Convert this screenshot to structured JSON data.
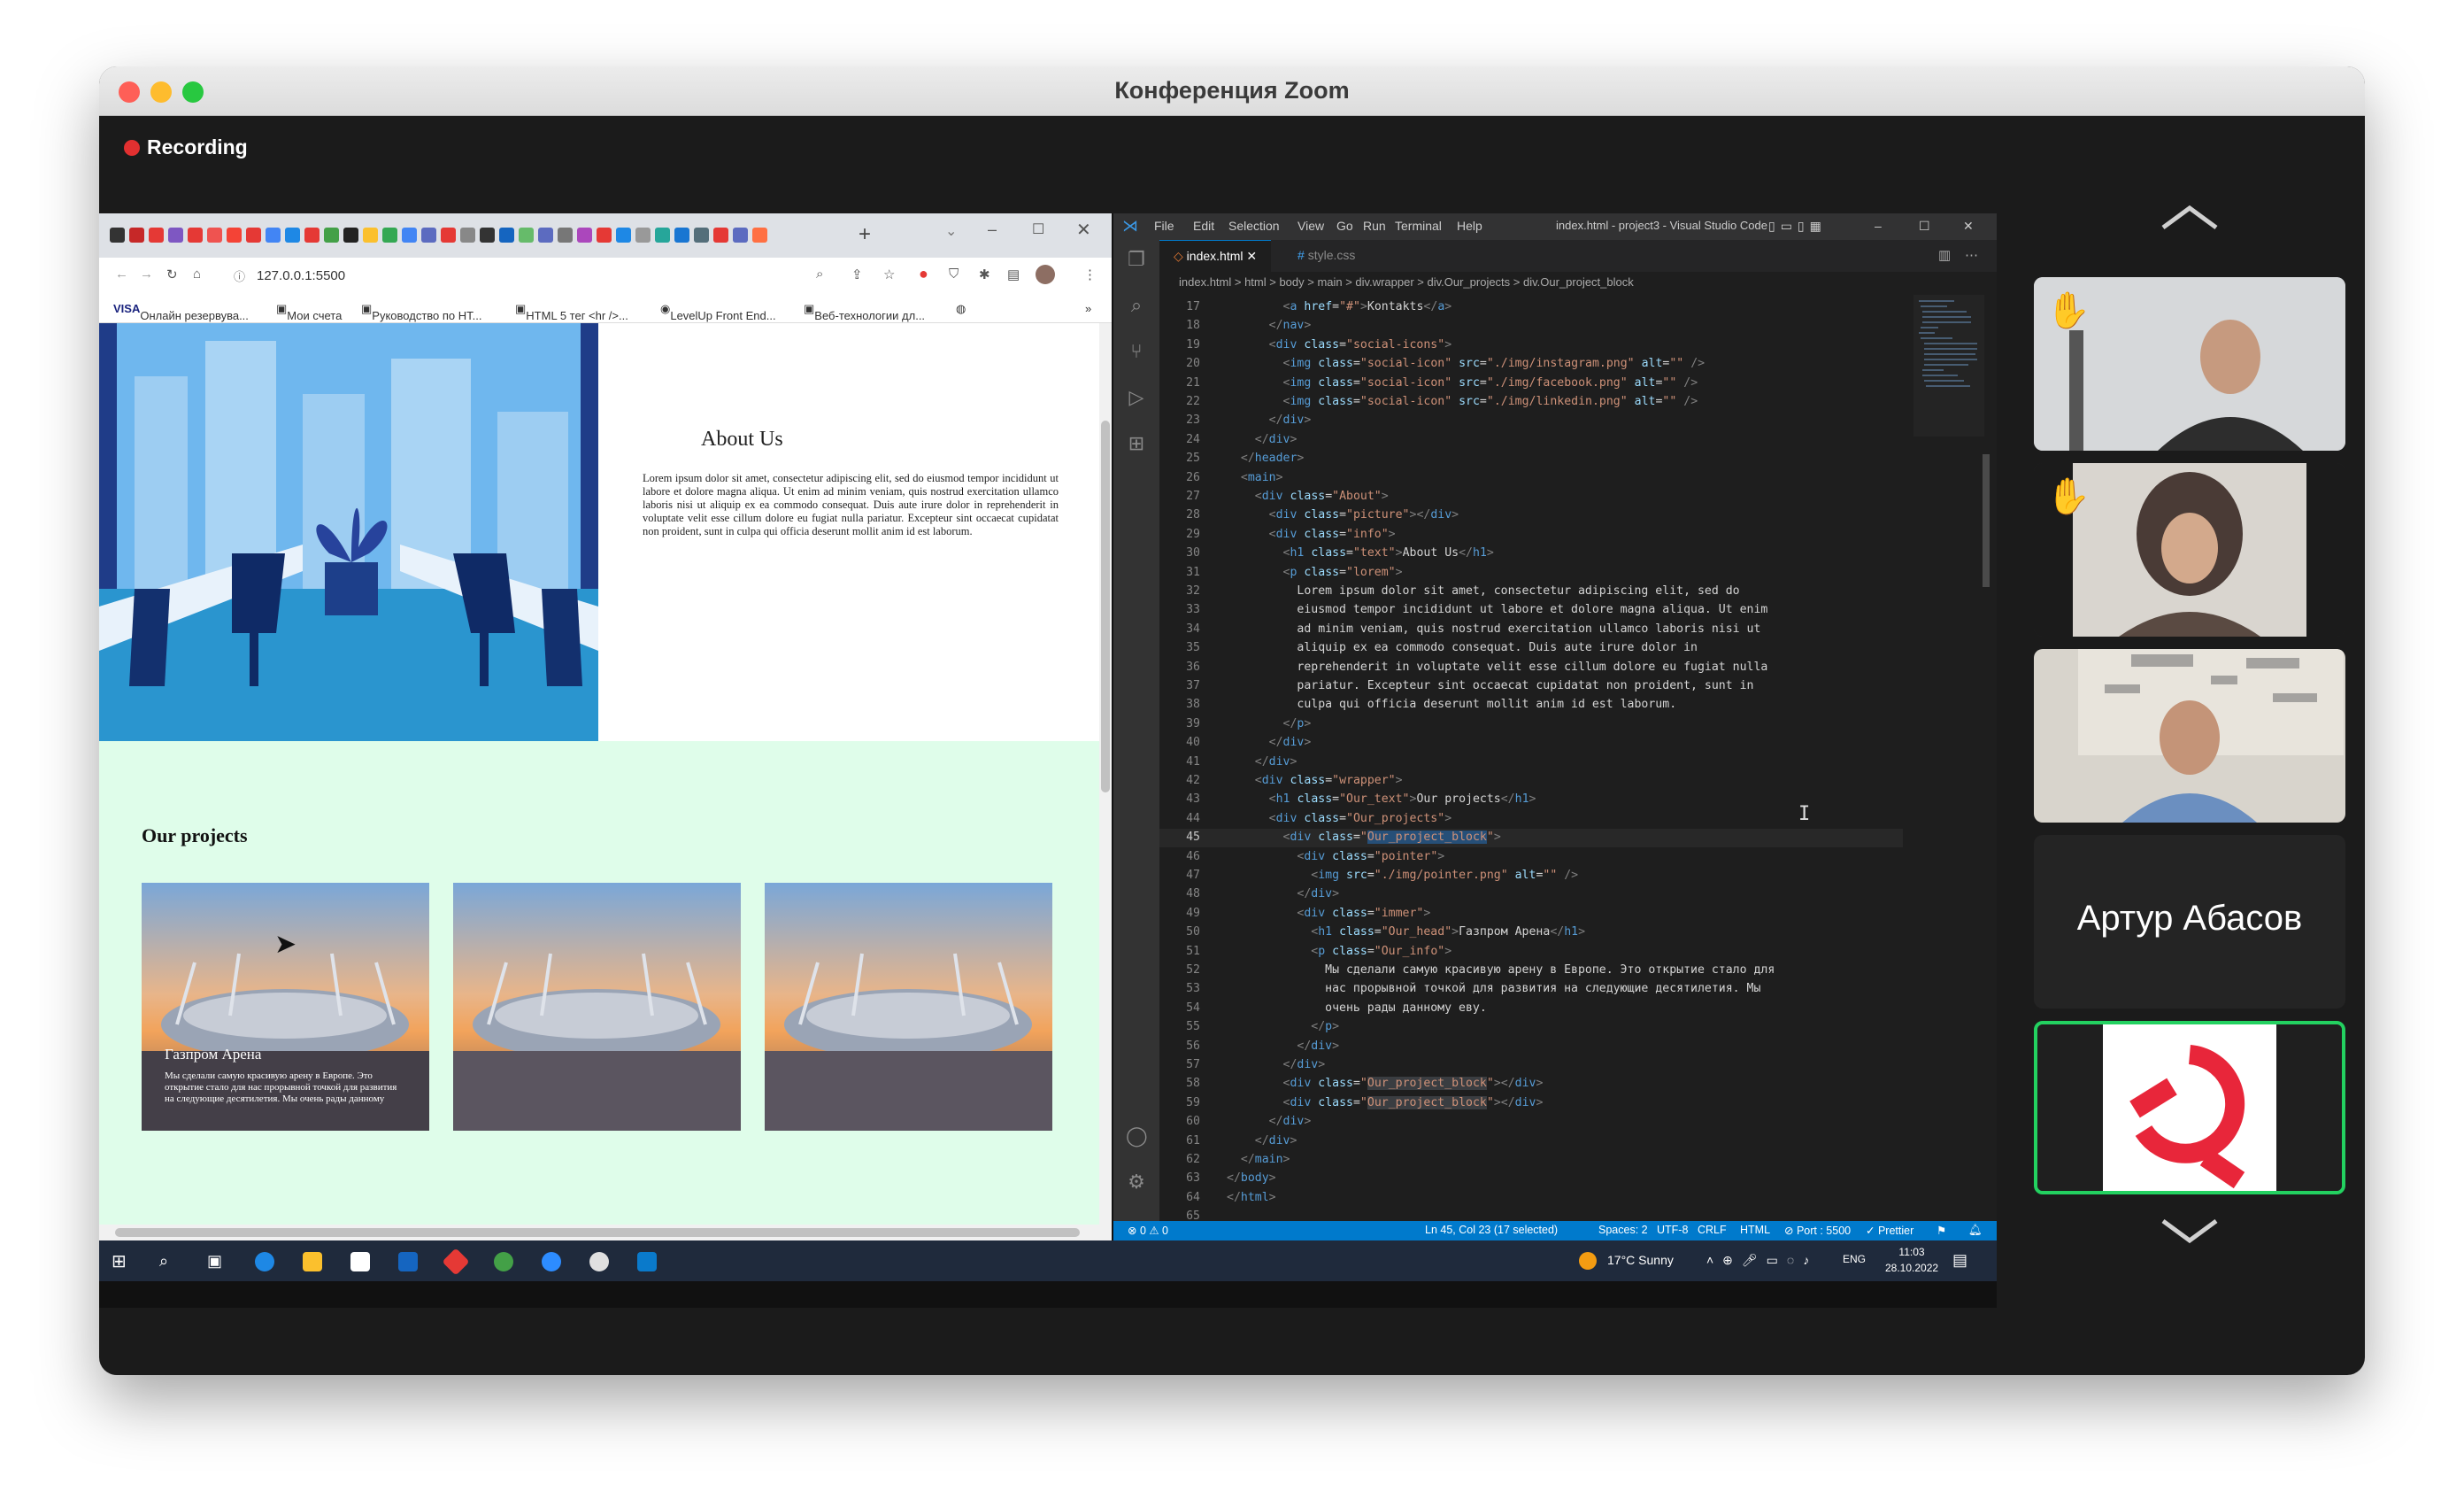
{
  "zoom": {
    "window_title": "Конференция Zoom",
    "recording_label": "Recording"
  },
  "browser": {
    "url": "127.0.0.1:5500",
    "bookmarks": [
      "Онлайн резервува...",
      "Мои счета",
      "Руководство по HT...",
      "HTML 5 тег <hr />...",
      "LevelUp Front End...",
      "Веб-технологии дл..."
    ],
    "page": {
      "about_title": "About Us",
      "about_text": "Lorem ipsum dolor sit amet, consectetur adipiscing elit, sed do eiusmod tempor incididunt ut labore et dolore magna aliqua. Ut enim ad minim veniam, quis nostrud exercitation ullamco laboris nisi ut aliquip ex ea commodo consequat. Duis aute irure dolor in reprehenderit in voluptate velit esse cillum dolore eu fugiat nulla pariatur. Excepteur sint occaecat cupidatat non proident, sunt in culpa qui officia deserunt mollit anim id est laborum.",
      "projects_title": "Our projects",
      "card_head": "Газпром Арена",
      "card_text": "Мы сделали самую красивую арену в Европе. Это открытие стало для нас прорывной точкой для развития на следующие десятилетия. Мы очень рады данному"
    }
  },
  "vscode": {
    "menu": [
      "File",
      "Edit",
      "Selection",
      "View",
      "Go",
      "Run",
      "Terminal",
      "Help"
    ],
    "window_title": "index.html - project3 - Visual Studio Code",
    "tabs": [
      "index.html",
      "style.css"
    ],
    "breadcrumbs": "index.html  >  html  >  body  >  main  >  div.wrapper  >  div.Our_projects  >  div.Our_project_block",
    "code_lines": [
      {
        "n": "17",
        "html": "        <span class='br'>&lt;</span><span class='tg'>a</span> <span class='at'>href</span>=<span class='st'>\"#\"</span><span class='br'>&gt;</span>Kontakts<span class='br'>&lt;/</span><span class='tg'>a</span><span class='br'>&gt;</span>"
      },
      {
        "n": "18",
        "html": "      <span class='br'>&lt;/</span><span class='tg'>nav</span><span class='br'>&gt;</span>"
      },
      {
        "n": "19",
        "html": "      <span class='br'>&lt;</span><span class='tg'>div</span> <span class='at'>class</span>=<span class='st'>\"social-icons\"</span><span class='br'>&gt;</span>"
      },
      {
        "n": "20",
        "html": "        <span class='br'>&lt;</span><span class='tg'>img</span> <span class='at'>class</span>=<span class='st'>\"social-icon\"</span> <span class='at'>src</span>=<span class='st'>\"./img/instagram.png\"</span> <span class='at'>alt</span>=<span class='st'>\"\"</span> <span class='br'>/&gt;</span>"
      },
      {
        "n": "21",
        "html": "        <span class='br'>&lt;</span><span class='tg'>img</span> <span class='at'>class</span>=<span class='st'>\"social-icon\"</span> <span class='at'>src</span>=<span class='st'>\"./img/facebook.png\"</span> <span class='at'>alt</span>=<span class='st'>\"\"</span> <span class='br'>/&gt;</span>"
      },
      {
        "n": "22",
        "html": "        <span class='br'>&lt;</span><span class='tg'>img</span> <span class='at'>class</span>=<span class='st'>\"social-icon\"</span> <span class='at'>src</span>=<span class='st'>\"./img/linkedin.png\"</span> <span class='at'>alt</span>=<span class='st'>\"\"</span> <span class='br'>/&gt;</span>"
      },
      {
        "n": "23",
        "html": "      <span class='br'>&lt;/</span><span class='tg'>div</span><span class='br'>&gt;</span>"
      },
      {
        "n": "24",
        "html": "    <span class='br'>&lt;/</span><span class='tg'>div</span><span class='br'>&gt;</span>"
      },
      {
        "n": "25",
        "html": "  <span class='br'>&lt;/</span><span class='tg'>header</span><span class='br'>&gt;</span>"
      },
      {
        "n": "26",
        "html": "  <span class='br'>&lt;</span><span class='tg'>main</span><span class='br'>&gt;</span>"
      },
      {
        "n": "27",
        "html": "    <span class='br'>&lt;</span><span class='tg'>div</span> <span class='at'>class</span>=<span class='st'>\"About\"</span><span class='br'>&gt;</span>"
      },
      {
        "n": "28",
        "html": "      <span class='br'>&lt;</span><span class='tg'>div</span> <span class='at'>class</span>=<span class='st'>\"picture\"</span><span class='br'>&gt;&lt;/</span><span class='tg'>div</span><span class='br'>&gt;</span>"
      },
      {
        "n": "29",
        "html": "      <span class='br'>&lt;</span><span class='tg'>div</span> <span class='at'>class</span>=<span class='st'>\"info\"</span><span class='br'>&gt;</span>"
      },
      {
        "n": "30",
        "html": "        <span class='br'>&lt;</span><span class='tg'>h1</span> <span class='at'>class</span>=<span class='st'>\"text\"</span><span class='br'>&gt;</span>About Us<span class='br'>&lt;/</span><span class='tg'>h1</span><span class='br'>&gt;</span>"
      },
      {
        "n": "31",
        "html": "        <span class='br'>&lt;</span><span class='tg'>p</span> <span class='at'>class</span>=<span class='st'>\"lorem\"</span><span class='br'>&gt;</span>"
      },
      {
        "n": "32",
        "html": "          Lorem ipsum dolor sit amet, consectetur adipiscing elit, sed do"
      },
      {
        "n": "33",
        "html": "          eiusmod tempor incididunt ut labore et dolore magna aliqua. Ut enim"
      },
      {
        "n": "34",
        "html": "          ad minim veniam, quis nostrud exercitation ullamco laboris nisi ut"
      },
      {
        "n": "35",
        "html": "          aliquip ex ea commodo consequat. Duis aute irure dolor in"
      },
      {
        "n": "36",
        "html": "          reprehenderit in voluptate velit esse cillum dolore eu fugiat nulla"
      },
      {
        "n": "37",
        "html": "          pariatur. Excepteur sint occaecat cupidatat non proident, sunt in"
      },
      {
        "n": "38",
        "html": "          culpa qui officia deserunt mollit anim id est laborum."
      },
      {
        "n": "39",
        "html": "        <span class='br'>&lt;/</span><span class='tg'>p</span><span class='br'>&gt;</span>"
      },
      {
        "n": "40",
        "html": "      <span class='br'>&lt;/</span><span class='tg'>div</span><span class='br'>&gt;</span>"
      },
      {
        "n": "41",
        "html": "    <span class='br'>&lt;/</span><span class='tg'>div</span><span class='br'>&gt;</span>"
      },
      {
        "n": "42",
        "html": "    <span class='br'>&lt;</span><span class='tg'>div</span> <span class='at'>class</span>=<span class='st'>\"wrapper\"</span><span class='br'>&gt;</span>"
      },
      {
        "n": "43",
        "html": "      <span class='br'>&lt;</span><span class='tg'>h1</span> <span class='at'>class</span>=<span class='st'>\"Our_text\"</span><span class='br'>&gt;</span>Our projects<span class='br'>&lt;/</span><span class='tg'>h1</span><span class='br'>&gt;</span>"
      },
      {
        "n": "44",
        "html": "      <span class='br'>&lt;</span><span class='tg'>div</span> <span class='at'>class</span>=<span class='st'>\"Our_projects\"</span><span class='br'>&gt;</span>"
      },
      {
        "n": "45",
        "html": "        <span class='br'>&lt;</span><span class='tg'>div</span> <span class='at'>class</span>=<span class='st'>\"<span style='background:#264f78'>Our_project_block</span>\"</span><span class='br'>&gt;</span>"
      },
      {
        "n": "46",
        "html": "          <span class='br'>&lt;</span><span class='tg'>div</span> <span class='at'>class</span>=<span class='st'>\"pointer\"</span><span class='br'>&gt;</span>"
      },
      {
        "n": "47",
        "html": "            <span class='br'>&lt;</span><span class='tg'>img</span> <span class='at'>src</span>=<span class='st'>\"./img/pointer.png\"</span> <span class='at'>alt</span>=<span class='st'>\"\"</span> <span class='br'>/&gt;</span>"
      },
      {
        "n": "48",
        "html": "          <span class='br'>&lt;/</span><span class='tg'>div</span><span class='br'>&gt;</span>"
      },
      {
        "n": "49",
        "html": "          <span class='br'>&lt;</span><span class='tg'>div</span> <span class='at'>class</span>=<span class='st'>\"immer\"</span><span class='br'>&gt;</span>"
      },
      {
        "n": "50",
        "html": "            <span class='br'>&lt;</span><span class='tg'>h1</span> <span class='at'>class</span>=<span class='st'>\"Our_head\"</span><span class='br'>&gt;</span>Газпром Арена<span class='br'>&lt;/</span><span class='tg'>h1</span><span class='br'>&gt;</span>"
      },
      {
        "n": "51",
        "html": "            <span class='br'>&lt;</span><span class='tg'>p</span> <span class='at'>class</span>=<span class='st'>\"Our_info\"</span><span class='br'>&gt;</span>"
      },
      {
        "n": "52",
        "html": "              Мы сделали самую красивую арену в Европе. Это открытие стало для"
      },
      {
        "n": "53",
        "html": "              нас прорывной точкой для развития на следующие десятилетия. Мы"
      },
      {
        "n": "54",
        "html": "              очень рады данному еву."
      },
      {
        "n": "55",
        "html": "            <span class='br'>&lt;/</span><span class='tg'>p</span><span class='br'>&gt;</span>"
      },
      {
        "n": "56",
        "html": "          <span class='br'>&lt;/</span><span class='tg'>div</span><span class='br'>&gt;</span>"
      },
      {
        "n": "57",
        "html": "        <span class='br'>&lt;/</span><span class='tg'>div</span><span class='br'>&gt;</span>"
      },
      {
        "n": "58",
        "html": "        <span class='br'>&lt;</span><span class='tg'>div</span> <span class='at'>class</span>=<span class='st'>\"<span style='background:#3a3d41'>Our_project_block</span>\"</span><span class='br'>&gt;&lt;/</span><span class='tg'>div</span><span class='br'>&gt;</span>"
      },
      {
        "n": "59",
        "html": "        <span class='br'>&lt;</span><span class='tg'>div</span> <span class='at'>class</span>=<span class='st'>\"<span style='background:#3a3d41'>Our_project_block</span>\"</span><span class='br'>&gt;&lt;/</span><span class='tg'>div</span><span class='br'>&gt;</span>"
      },
      {
        "n": "60",
        "html": "      <span class='br'>&lt;/</span><span class='tg'>div</span><span class='br'>&gt;</span>"
      },
      {
        "n": "61",
        "html": "    <span class='br'>&lt;/</span><span class='tg'>div</span><span class='br'>&gt;</span>"
      },
      {
        "n": "62",
        "html": "  <span class='br'>&lt;/</span><span class='tg'>main</span><span class='br'>&gt;</span>"
      },
      {
        "n": "63",
        "html": "<span class='br'>&lt;/</span><span class='tg'>body</span><span class='br'>&gt;</span>"
      },
      {
        "n": "64",
        "html": "<span class='br'>&lt;/</span><span class='tg'>html</span><span class='br'>&gt;</span>"
      },
      {
        "n": "65",
        "html": ""
      }
    ],
    "status": {
      "problems": "⊗ 0 ⚠ 0",
      "cursor": "Ln 45, Col 23 (17 selected)",
      "spaces": "Spaces: 2",
      "encoding": "UTF-8",
      "eol": "CRLF",
      "language": "HTML",
      "port": "⊘ Port : 5500",
      "prettier": "✓ Prettier"
    }
  },
  "taskbar": {
    "weather": "17°C  Sunny",
    "lang": "ENG",
    "time": "11:03",
    "date": "28.10.2022"
  },
  "participants": {
    "name_tile": "Артур Абасов"
  }
}
